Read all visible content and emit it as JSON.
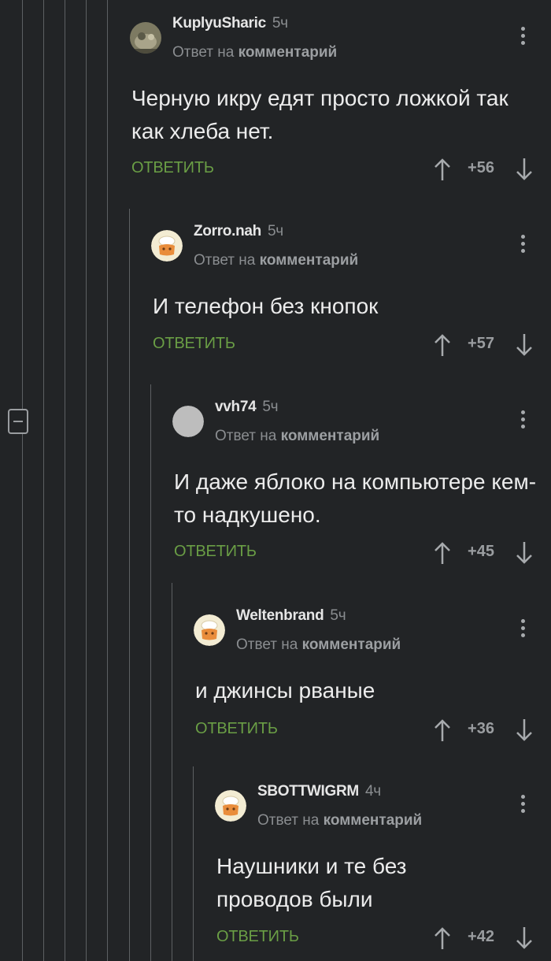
{
  "reply_prefix": "Ответ на",
  "reply_target": "комментарий",
  "reply_label": "ОТВЕТИТЬ",
  "comments": [
    {
      "author": "KuplyuSharic",
      "time": "5ч",
      "text": "Черную икру едят просто ложкой так как хлеба нет.",
      "rating": "+56",
      "avatar": "photo"
    },
    {
      "author": "Zorro.nah",
      "time": "5ч",
      "text": "И телефон без кнопок",
      "rating": "+57",
      "avatar": "default-chef"
    },
    {
      "author": "vvh74",
      "time": "5ч",
      "text": "И даже яблоко на компьютере кем-то надкушено.",
      "rating": "+45",
      "avatar": "gray-circle"
    },
    {
      "author": "Weltenbrand",
      "time": "5ч",
      "text": "и джинсы рваные",
      "rating": "+36",
      "avatar": "default-chef"
    },
    {
      "author": "SBOTTWIGRM",
      "time": "4ч",
      "text": "Наушники и те без проводов были",
      "rating": "+42",
      "avatar": "default-chef"
    }
  ],
  "colors": {
    "background": "#222426",
    "reply_green": "#6a9e45",
    "muted": "#8a8d90",
    "text": "#ececec"
  }
}
